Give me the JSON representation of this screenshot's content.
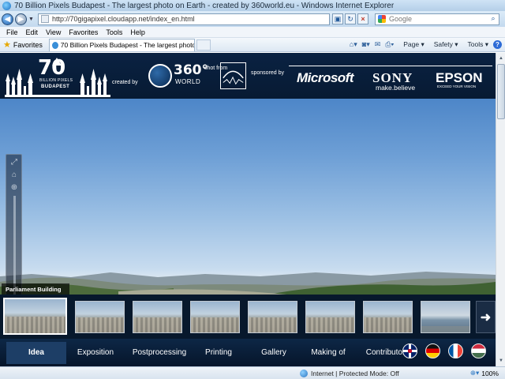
{
  "window": {
    "title": "70 Billion Pixels Budapest - The largest photo on Earth - created by 360world.eu - Windows Internet Explorer"
  },
  "address_bar": {
    "url": "http://70gigapixel.cloudapp.net/index_en.html",
    "search_placeholder": "Google"
  },
  "menu": [
    "File",
    "Edit",
    "View",
    "Favorites",
    "Tools",
    "Help"
  ],
  "favorites_bar": {
    "favorites_label": "Favorites",
    "tab_label": "70 Billion Pixels Budapest - The largest photo on ...",
    "commands": [
      "Page",
      "Safety",
      "Tools"
    ]
  },
  "site_header": {
    "logo_number": "70",
    "logo_line1": "BILLION PIXELS",
    "logo_line2": "BUDAPEST",
    "created_by": "created by",
    "brand_360": "360°",
    "brand_world": "WORLD",
    "shot_from": "shot from",
    "sponsored_by": "sponsored by",
    "sponsor_1": "Microsoft",
    "sponsor_2": "SONY",
    "sponsor_2_sub": "make.believe",
    "sponsor_3": "EPSON",
    "sponsor_3_sub": "EXCEED YOUR VISION"
  },
  "viewer": {
    "current_thumb_label": "Parliament Building",
    "thumbnails": [
      "thumb-1",
      "thumb-2",
      "thumb-3",
      "thumb-4",
      "thumb-5",
      "thumb-6",
      "thumb-7",
      "thumb-8"
    ]
  },
  "nav": {
    "items": [
      "Idea",
      "Exposition",
      "Postprocessing",
      "Printing",
      "Gallery",
      "Making of",
      "Contributors"
    ],
    "active": "Idea",
    "languages": [
      "English",
      "German",
      "French",
      "Hungarian"
    ]
  },
  "status_bar": {
    "zone": "Internet | Protected Mode: Off",
    "zoom": "100%"
  },
  "colors": {
    "header_bg": "#0a2242",
    "nav_active": "#1d3e66",
    "sky_top": "#4d86c8"
  }
}
